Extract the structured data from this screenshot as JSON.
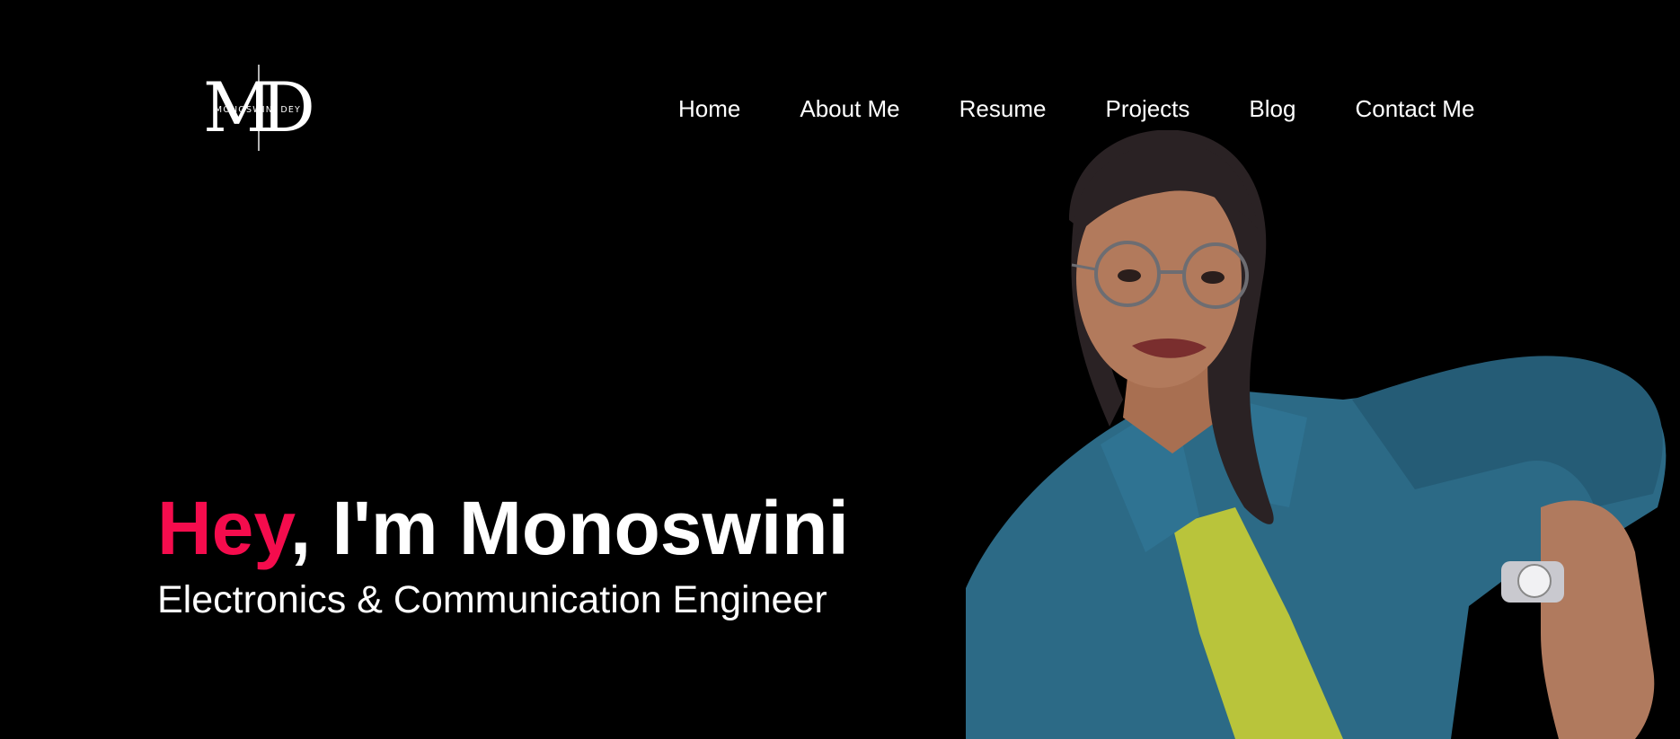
{
  "brand": {
    "monogram_left": "M",
    "monogram_right": "D",
    "logo_name": "MONOSWINI DEY"
  },
  "nav": {
    "items": [
      {
        "label": "Home"
      },
      {
        "label": "About Me"
      },
      {
        "label": "Resume"
      },
      {
        "label": "Projects"
      },
      {
        "label": "Blog"
      },
      {
        "label": "Contact Me"
      }
    ]
  },
  "hero": {
    "greeting": "Hey",
    "greeting_rest": ", I'm Monoswini",
    "subtitle": "Electronics & Communication Engineer",
    "photo_icon": "portrait-photo-icon"
  },
  "colors": {
    "background": "#000000",
    "text": "#ffffff",
    "accent": "#f50c4d",
    "shirt": "#2c6a86",
    "tshirt": "#b9c43b"
  }
}
